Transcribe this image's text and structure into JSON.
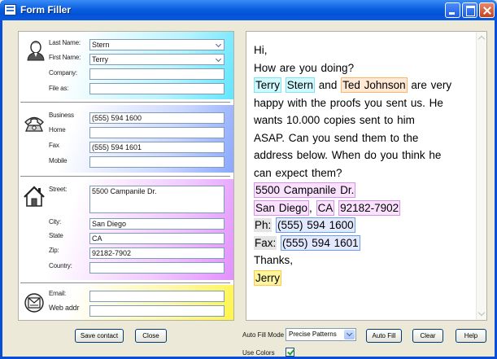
{
  "window": {
    "title": "Form Filler"
  },
  "name_section": {
    "last_name_label": "Last Name:",
    "last_name_value": "Stern",
    "first_name_label": "First Name:",
    "first_name_value": "Terry",
    "company_label": "Company:",
    "company_value": "",
    "file_as_label": "File as:",
    "file_as_value": ""
  },
  "phone_section": {
    "business_label": "Business",
    "business_value": "(555) 594 1600",
    "home_label": "Home",
    "home_value": "",
    "fax_label": "Fax",
    "fax_value": "(555) 594 1601",
    "mobile_label": "Mobile",
    "mobile_value": ""
  },
  "address_section": {
    "street_label": "Street:",
    "street_value": "5500 Campanile Dr.",
    "city_label": "City:",
    "city_value": "San Diego",
    "state_label": "State",
    "state_value": "CA",
    "zip_label": "Zip:",
    "zip_value": "92182-7902",
    "country_label": "Country:",
    "country_value": ""
  },
  "email_section": {
    "email_label": "Email:",
    "email_value": "",
    "web_label": "Web addr",
    "web_value": ""
  },
  "buttons": {
    "save_contact": "Save contact",
    "close": "Close",
    "auto_fill": "Auto Fill",
    "clear": "Clear",
    "help": "Help"
  },
  "options": {
    "auto_fill_mode_label": "Auto Fill Mode",
    "auto_fill_mode_value": "Precise Patterns",
    "use_colors_label": "Use Colors",
    "use_colors_checked": true
  },
  "letter": {
    "l1": "Hi,",
    "l2": "How are you doing?",
    "l3_first": "Terry",
    "l3_last": "Stern",
    "l3_and": " and ",
    "l3_person": "Ted Johnson",
    "l3_rest": " are very",
    "l4": "happy with the proofs you sent us. He",
    "l5": "wants 10.000 copies sent to him",
    "l6": "ASAP. Can you send them to the",
    "l7": "address below. When do you think he",
    "l8": "can expect them?",
    "l9_street": "5500 Campanile Dr.",
    "l10_city": "San Diego",
    "l10_comma": ", ",
    "l10_state": "CA",
    "l10_space": " ",
    "l10_zip": "92182-7902",
    "l11_label": "Ph:",
    "l11_phone": "(555) 594 1600",
    "l12_label": "Fax:",
    "l12_fax": "(555) 594 1601",
    "l13": "Thanks,",
    "l14_sign": "Jerry"
  },
  "colors": {
    "name_accent": "#60e6ff",
    "phone_accent": "#8aa8ff",
    "address_accent": "#e190ff",
    "email_accent": "#fff54a",
    "titlebar": "#0a5fe0"
  }
}
